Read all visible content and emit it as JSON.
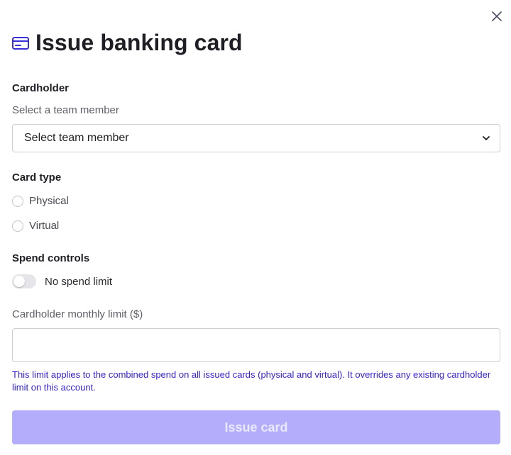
{
  "dialog": {
    "title": "Issue banking card",
    "title_icon": "credit-card-icon",
    "close_icon": "close-icon"
  },
  "cardholder": {
    "section_label": "Cardholder",
    "sub_label": "Select a team member",
    "select_value": "Select team member",
    "chevron_icon": "chevron-down-icon"
  },
  "card_type": {
    "section_label": "Card type",
    "options": [
      {
        "label": "Physical",
        "selected": false
      },
      {
        "label": "Virtual",
        "selected": false
      }
    ]
  },
  "spend_controls": {
    "section_label": "Spend controls",
    "toggle_label": "No spend limit",
    "toggle_on": false
  },
  "monthly_limit": {
    "label": "Cardholder monthly limit ($)",
    "value": "",
    "help_text": "This limit applies to the combined spend on all issued cards (physical and virtual). It overrides any existing cardholder limit on this account."
  },
  "actions": {
    "issue_label": "Issue card"
  },
  "colors": {
    "accent": "#3322d8",
    "button_disabled_bg": "#b3adfb",
    "icon_primary": "#3a2fd6"
  }
}
